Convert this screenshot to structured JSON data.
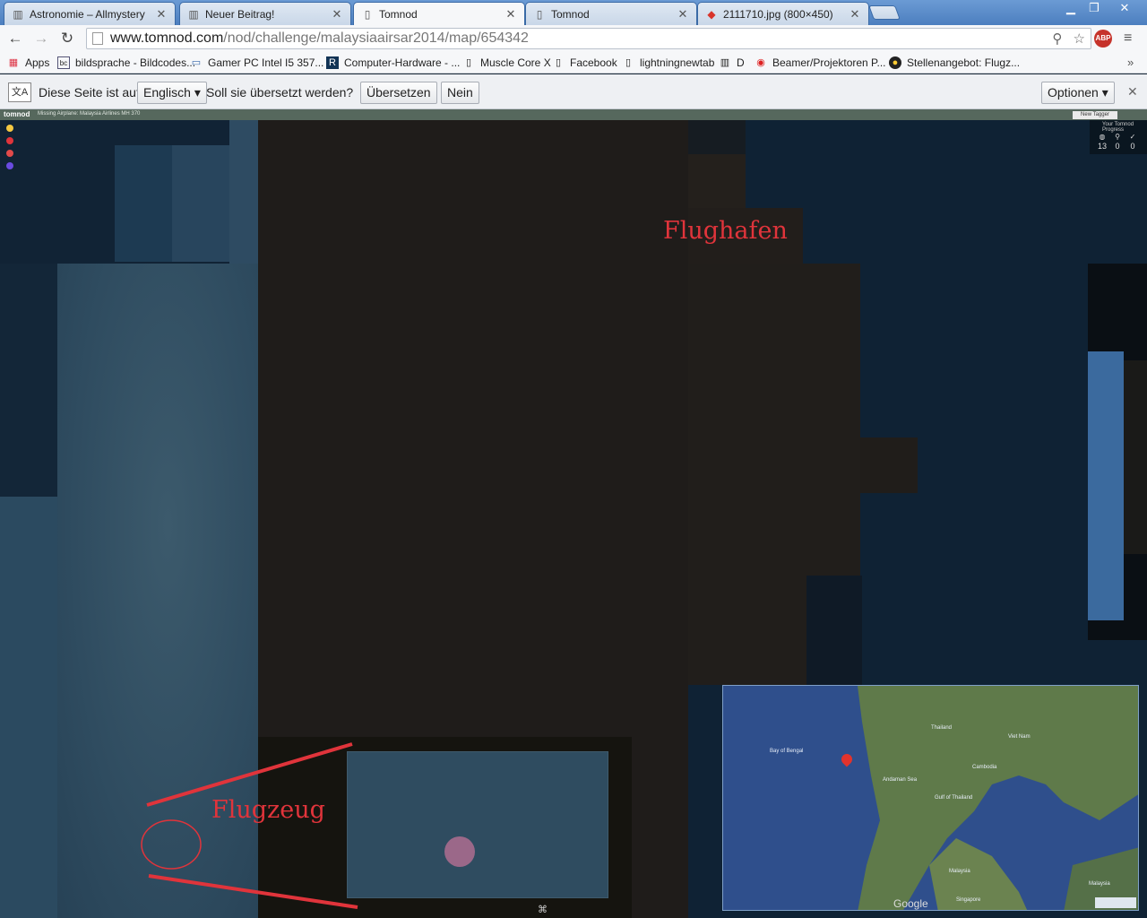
{
  "tabs": [
    {
      "label": "Astronomie – Allmystery",
      "icon": "allmystery-favicon"
    },
    {
      "label": "Neuer Beitrag!",
      "icon": "allmystery-favicon"
    },
    {
      "label": "Tomnod",
      "icon": "page-icon"
    },
    {
      "label": "Tomnod",
      "icon": "page-icon"
    },
    {
      "label": "2111710.jpg (800×450)",
      "icon": "image-favicon"
    }
  ],
  "tab_close": "✕",
  "window_controls": {
    "minimize": "▁",
    "maximize": "❐",
    "close": "✕"
  },
  "toolbar": {
    "back": "←",
    "forward": "→",
    "reload": "↻",
    "url_host": "www.tomnod.com",
    "url_path": "/nod/challenge/malaysiaairsar2014/map/654342",
    "abp_label": "ABP",
    "menu": "≡"
  },
  "bookmarks": [
    {
      "label": "Apps",
      "icon": "apps-grid-icon"
    },
    {
      "label": "bildsprache - Bildcodes...",
      "icon": "bc-favicon"
    },
    {
      "label": "Gamer PC Intel I5 357...",
      "icon": "pc-favicon"
    },
    {
      "label": "Computer-Hardware - ...",
      "icon": "hardware-favicon"
    },
    {
      "label": "Muscle Core X",
      "icon": "page-icon"
    },
    {
      "label": "Facebook",
      "icon": "page-icon"
    },
    {
      "label": "lightningnewtab",
      "icon": "page-icon"
    },
    {
      "label": "D",
      "icon": "allmystery-favicon"
    },
    {
      "label": "Beamer/Projektoren P...",
      "icon": "beamer-favicon"
    },
    {
      "label": "Stellenangebot: Flugz...",
      "icon": "job-favicon"
    }
  ],
  "bookmarks_more": "»",
  "translate_bar": {
    "prefix": "Diese Seite ist auf",
    "language": "Englisch",
    "question": "Soll sie übersetzt werden?",
    "translate_button": "Übersetzen",
    "no_button": "Nein",
    "options_button": "Optionen",
    "close": "✕"
  },
  "map": {
    "logo": "tomnod",
    "title": "Missing Airplane: Malaysia Airlines MH 370",
    "new_tag_button": "New Tagger",
    "stats_label": "Your Tomnod Progress",
    "stats": [
      {
        "icon": "map-icon",
        "value": "13"
      },
      {
        "icon": "pin-icon",
        "value": "0"
      },
      {
        "icon": "check-icon",
        "value": "0"
      }
    ],
    "legend_colors": [
      "#f5c842",
      "#e0343b",
      "#e24a4a",
      "#6a4be0"
    ],
    "annotation_airport": "Flughafen",
    "annotation_plane": "Flugzeug",
    "annotation_color": "#e0343b",
    "minimap": {
      "labels": [
        "Bay of Bengal",
        "Andaman Sea",
        "Thailand",
        "Viet Nam",
        "Cambodia",
        "Gulf of Thailand",
        "Malaysia",
        "Singapore",
        "Malaysia"
      ],
      "google": "Google"
    }
  }
}
